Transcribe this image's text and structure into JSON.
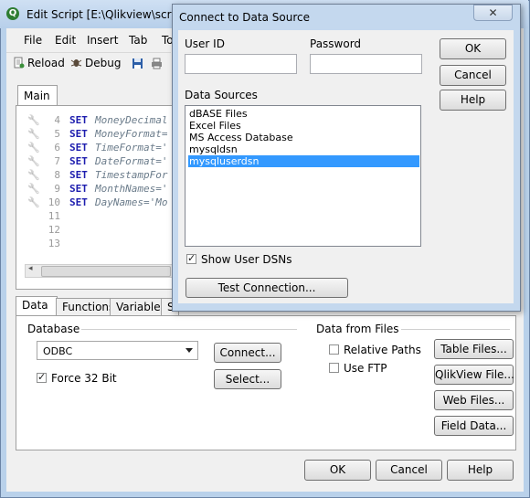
{
  "window": {
    "title": "Edit Script [E:\\Qlikview\\scripts",
    "app_icon": "Q",
    "menu": [
      "File",
      "Edit",
      "Insert",
      "Tab",
      "To"
    ],
    "toolbar": {
      "reload_label": "Reload",
      "debug_label": "Debug"
    }
  },
  "editor": {
    "tab_label": "Main",
    "lines": [
      {
        "num": "4",
        "kw": "SET",
        "rest": "MoneyDecimal"
      },
      {
        "num": "5",
        "kw": "SET",
        "rest": "MoneyFormat="
      },
      {
        "num": "6",
        "kw": "SET",
        "rest": "TimeFormat='"
      },
      {
        "num": "7",
        "kw": "SET",
        "rest": "DateFormat='"
      },
      {
        "num": "8",
        "kw": "SET",
        "rest": "TimestampFor"
      },
      {
        "num": "9",
        "kw": "SET",
        "rest": "MonthNames='"
      },
      {
        "num": "10",
        "kw": "SET",
        "rest": "DayNames='Mo"
      },
      {
        "num": "11",
        "kw": "",
        "rest": ""
      },
      {
        "num": "12",
        "kw": "",
        "rest": ""
      },
      {
        "num": "13",
        "kw": "",
        "rest": ""
      }
    ]
  },
  "lower_panel": {
    "tabs": [
      "Data",
      "Functions",
      "Variables",
      "S"
    ],
    "database": {
      "label": "Database",
      "selected": "ODBC",
      "connect_label": "Connect...",
      "select_label": "Select...",
      "force32_label": "Force 32 Bit",
      "force32_checked": true
    },
    "data_from_files": {
      "label": "Data from Files",
      "relative_paths_label": "Relative Paths",
      "relative_paths_checked": false,
      "use_ftp_label": "Use FTP",
      "use_ftp_checked": false,
      "table_files_label": "Table Files...",
      "qlikview_file_label": "QlikView File...",
      "web_files_label": "Web Files...",
      "field_data_label": "Field Data..."
    },
    "ok_label": "OK",
    "cancel_label": "Cancel",
    "help_label": "Help"
  },
  "dialog": {
    "title": "Connect to Data Source",
    "close_glyph": "✕",
    "user_id_label": "User ID",
    "user_id_value": "",
    "password_label": "Password",
    "password_value": "",
    "data_sources_label": "Data Sources",
    "data_sources": [
      "dBASE Files",
      "Excel Files",
      "MS Access Database",
      "mysqldsn",
      "mysqluserdsn"
    ],
    "selected_source": "mysqluserdsn",
    "show_user_dsns_label": "Show User DSNs",
    "show_user_dsns_checked": true,
    "test_connection_label": "Test Connection...",
    "ok_label": "OK",
    "cancel_label": "Cancel",
    "help_label": "Help"
  },
  "colors": {
    "selection": "#3399ff",
    "keyword": "#1c1cae",
    "window_frame": "#b9d1ea"
  }
}
